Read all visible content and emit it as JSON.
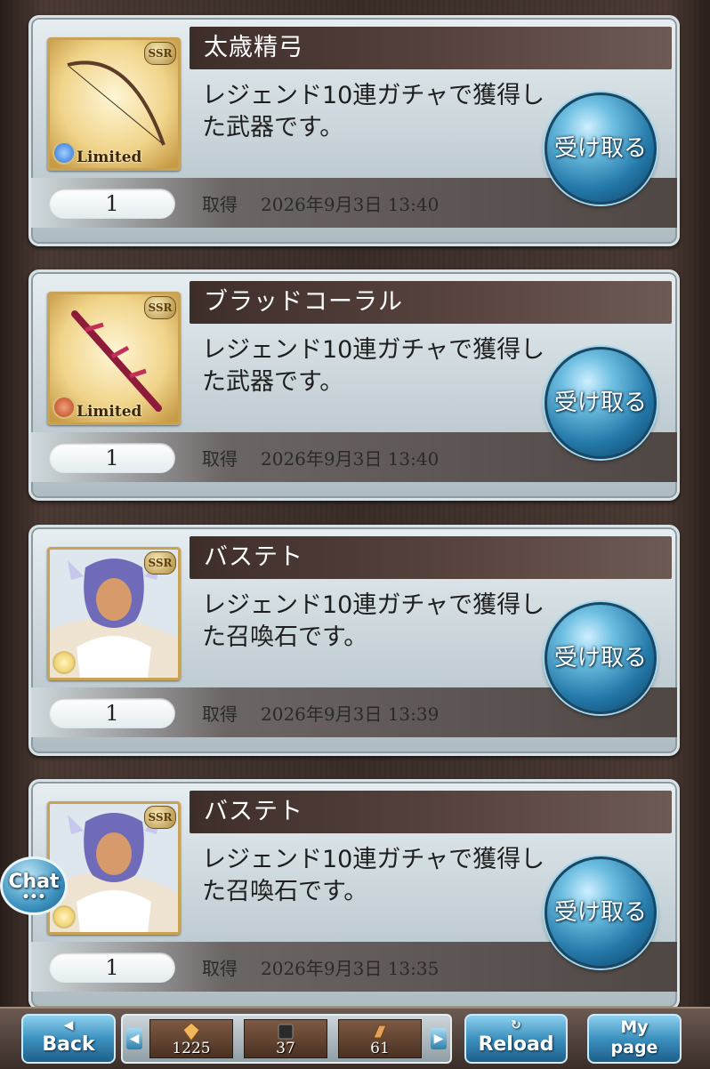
{
  "items": [
    {
      "title": "太歳精弓",
      "description": "レジェンド10連ガチャで獲得した武器です。",
      "rarity_badge": "SSR",
      "limited_label": "Limited",
      "element": "water",
      "element_color": "#2a6fd6",
      "type": "weapon-bow",
      "quantity": "1",
      "acquired_label": "取得",
      "acquired_date": "2026年9月3日 13:40",
      "receive_label": "受け取る"
    },
    {
      "title": "ブラッドコーラル",
      "description": "レジェンド10連ガチャで獲得した武器です。",
      "rarity_badge": "SSR",
      "limited_label": "Limited",
      "element": "fire",
      "element_color": "#b8431f",
      "type": "weapon-sword",
      "quantity": "1",
      "acquired_label": "取得",
      "acquired_date": "2026年9月3日 13:40",
      "receive_label": "受け取る"
    },
    {
      "title": "バステト",
      "description": "レジェンド10連ガチャで獲得した召喚石です。",
      "rarity_badge": "SSR",
      "element": "light",
      "element_color": "#e8c54a",
      "type": "summon",
      "quantity": "1",
      "acquired_label": "取得",
      "acquired_date": "2026年9月3日 13:39",
      "receive_label": "受け取る"
    },
    {
      "title": "バステト",
      "description": "レジェンド10連ガチャで獲得した召喚石です。",
      "rarity_badge": "SSR",
      "element": "light",
      "element_color": "#e8c54a",
      "type": "summon",
      "quantity": "1",
      "acquired_label": "取得",
      "acquired_date": "2026年9月3日 13:35",
      "receive_label": "受け取る"
    }
  ],
  "chat": {
    "label": "Chat",
    "dots": "•••"
  },
  "footer": {
    "back": {
      "icon": "◀",
      "label": "Back"
    },
    "resources": [
      {
        "icon": "crystal-icon",
        "value": "1225"
      },
      {
        "icon": "ticket-icon",
        "value": "37"
      },
      {
        "icon": "gold-bar-icon",
        "value": "61"
      }
    ],
    "reload": {
      "icon": "↻",
      "label": "Reload"
    },
    "mypage": {
      "label_line1": "My",
      "label_line2": "page"
    },
    "prev_arrow": "◀",
    "next_arrow": "▶"
  }
}
